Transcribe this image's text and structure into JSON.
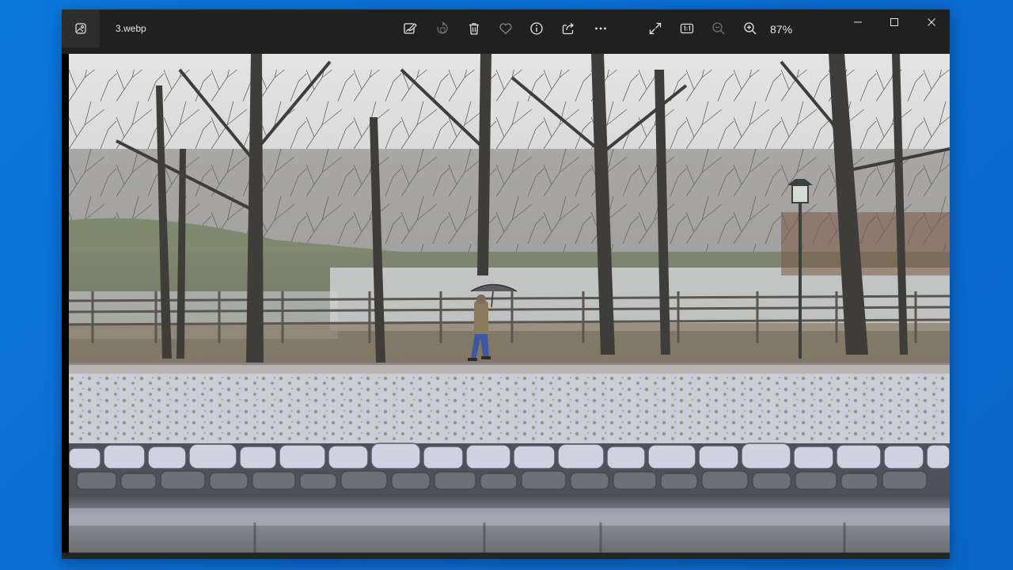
{
  "window": {
    "filename": "3.webp",
    "zoom_level": "87%"
  },
  "toolbar": {
    "items": [
      {
        "name": "edit-image",
        "icon": "edit-image-icon"
      },
      {
        "name": "rotate",
        "icon": "rotate-icon"
      },
      {
        "name": "delete",
        "icon": "trash-icon"
      },
      {
        "name": "favorite",
        "icon": "heart-icon"
      },
      {
        "name": "file-info",
        "icon": "info-icon"
      },
      {
        "name": "share",
        "icon": "share-icon"
      },
      {
        "name": "more",
        "icon": "more-icon"
      },
      {
        "name": "full-screen",
        "icon": "expand-icon"
      },
      {
        "name": "actual-size",
        "icon": "actual-size-icon"
      },
      {
        "name": "zoom-out",
        "icon": "zoom-out-icon"
      },
      {
        "name": "zoom-in",
        "icon": "zoom-in-icon"
      }
    ]
  },
  "window_controls": [
    "minimize",
    "maximize",
    "close"
  ],
  "colors": {
    "desktop": "#0a6fd6",
    "titlebar": "#202020",
    "icon": "#e6e6e6",
    "icon_disabled": "#6f6f6f"
  }
}
